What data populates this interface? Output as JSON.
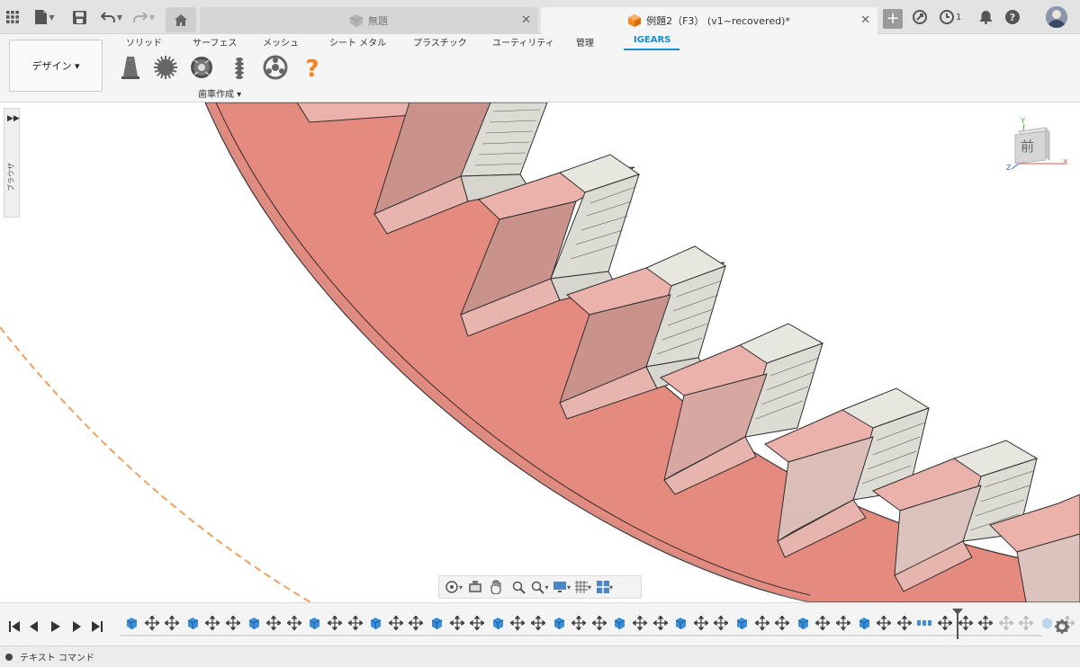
{
  "titlebar": {
    "home_tab": "home",
    "tabs": [
      {
        "label": "無題",
        "state": "inactive"
      },
      {
        "label": "例題2（F3） (v1~recovered)*",
        "state": "active"
      }
    ],
    "jobs_count": "1"
  },
  "ribbon": {
    "workspace_button": "デザイン ▾",
    "tabs": [
      "ソリッド",
      "サーフェス",
      "メッシュ",
      "シート メタル",
      "プラスチック",
      "ユーティリティ",
      "管理",
      "IGEARS"
    ],
    "active_tab": "IGEARS",
    "group_label": "歯車作成 ▾",
    "tools": [
      "bevel-gear-icon",
      "spur-gear-icon",
      "helical-gear-icon",
      "worm-gear-icon",
      "planetary-gear-icon",
      "help-icon"
    ]
  },
  "browser": {
    "label": "ブラウザ"
  },
  "viewcube": {
    "face": "前",
    "axis_x": "X",
    "axis_y": "Y",
    "axis_z": "Z"
  },
  "timeline": {
    "items": [
      "body",
      "move",
      "move",
      "body",
      "move",
      "move",
      "body",
      "move",
      "move",
      "body",
      "move",
      "move",
      "body",
      "move",
      "move",
      "body",
      "move",
      "move",
      "body",
      "move",
      "move",
      "body",
      "move",
      "move",
      "body",
      "move",
      "move",
      "body",
      "move",
      "move",
      "body",
      "move",
      "move",
      "body",
      "move",
      "move",
      "body",
      "move",
      "move",
      "pattern",
      "move",
      "move",
      "move",
      "move-suppressed",
      "move-suppressed",
      "body-suppressed",
      "move-suppressed"
    ]
  },
  "command_bar": {
    "label": "テキスト コマンド"
  },
  "colors": {
    "accent": "#1a8ccc",
    "gear_face": "#e58a7e",
    "gear_tooth_side": "#f0b8b0",
    "tooth_band": "#dcdcd4",
    "dashed_circle": "#f0a060"
  }
}
